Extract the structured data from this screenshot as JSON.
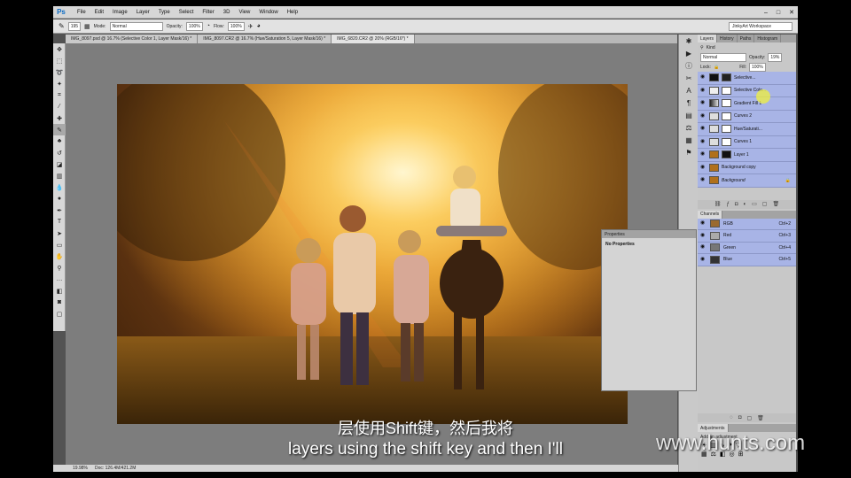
{
  "app": {
    "logo": "Ps"
  },
  "menu": [
    "File",
    "Edit",
    "Image",
    "Layer",
    "Type",
    "Select",
    "Filter",
    "3D",
    "View",
    "Window",
    "Help"
  ],
  "window_controls": [
    "–",
    "□",
    "✕"
  ],
  "options_bar": {
    "brush_size": "195",
    "mode_label": "Mode:",
    "mode_value": "Normal",
    "opacity_label": "Opacity:",
    "opacity_value": "100%",
    "flow_label": "Flow:",
    "flow_value": "100%",
    "workspace": "JinkyArt Workspace"
  },
  "doc_tabs": [
    {
      "label": "IMG_8097.psd @ 16.7% (Selective Color 1, Layer Mask/16) *",
      "active": false
    },
    {
      "label": "IMG_8097.CR2 @ 16.7% (Hue/Saturation 5, Layer Mask/16) *",
      "active": false
    },
    {
      "label": "IMG_6820.CR2 @ 20% (RGB/16*) *",
      "active": true
    }
  ],
  "layers_panel": {
    "tabs": [
      "Layers",
      "History",
      "Paths",
      "Histogram"
    ],
    "kind_label": "Kind",
    "blend_mode": "Normal",
    "opacity_label": "Opacity:",
    "opacity_value": "19%",
    "lock_label": "Lock:",
    "fill_label": "Fill:",
    "fill_value": "100%",
    "layers": [
      {
        "name": "Selective...",
        "selected": true
      },
      {
        "name": "Selective Colo...",
        "selected": true
      },
      {
        "name": "Gradient Fill 1",
        "selected": true
      },
      {
        "name": "Curves 2",
        "selected": true
      },
      {
        "name": "Hue/Saturati...",
        "selected": true
      },
      {
        "name": "Curves 1",
        "selected": true
      },
      {
        "name": "Layer 1",
        "selected": true
      },
      {
        "name": "Background copy",
        "selected": true
      },
      {
        "name": "Background",
        "selected": true
      }
    ]
  },
  "channels_panel": {
    "title": "Channels",
    "channels": [
      {
        "name": "RGB",
        "shortcut": "Ctrl+2"
      },
      {
        "name": "Red",
        "shortcut": "Ctrl+3"
      },
      {
        "name": "Green",
        "shortcut": "Ctrl+4"
      },
      {
        "name": "Blue",
        "shortcut": "Ctrl+5"
      }
    ]
  },
  "properties_panel": {
    "title": "Properties",
    "content": "No Properties"
  },
  "adjustments_panel": {
    "title": "Adjustments",
    "subtitle": "Add an adjustment"
  },
  "status_bar": {
    "zoom": "19.98%",
    "doc_info": "Doc: 126.4M/421.2M"
  },
  "subtitles": {
    "cn": "层使用Shift键，然后我将",
    "en": "layers using the shift key and then I'll"
  },
  "watermark": "www.hunts.com"
}
